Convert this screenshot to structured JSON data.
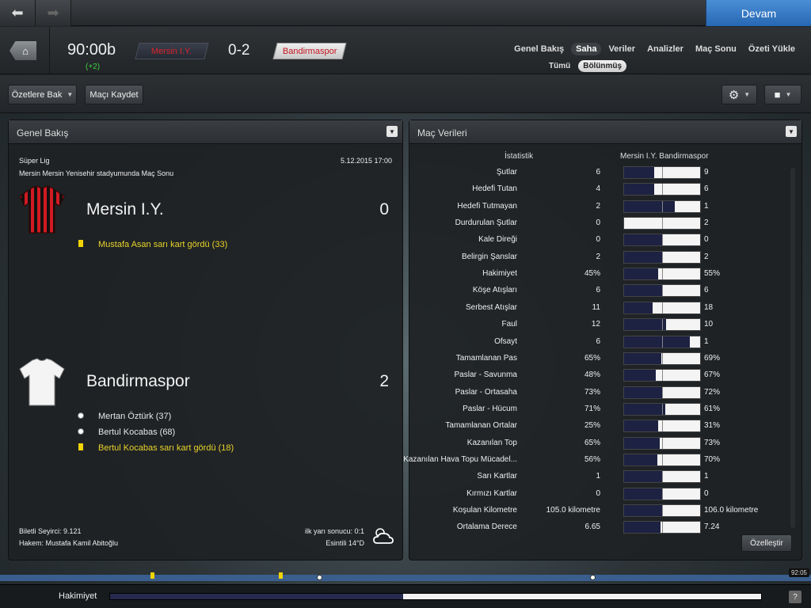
{
  "nav": {
    "continue_label": "Devam"
  },
  "header": {
    "clock": "90:00b",
    "added_time": "(+2)",
    "home_team": "Mersin I.Y.",
    "away_team": "Bandirmaspor",
    "score": "0-2",
    "tabs": [
      "Genel Bakış",
      "Saha",
      "Veriler",
      "Analizler",
      "Maç Sonu",
      "Özeti Yükle"
    ],
    "active_tab": "Saha",
    "subtabs": [
      "Tümü",
      "Bölünmüş"
    ],
    "active_subtab": "Bölünmüş"
  },
  "toolbar": {
    "highlights_label": "Özetlere Bak",
    "save_label": "Maçı Kaydet"
  },
  "overview": {
    "title": "Genel Bakış",
    "league": "Süper Lig",
    "datetime": "5.12.2015 17:00",
    "venue": "Mersin Mersin Yenisehir stadyumunda Maç Sonu",
    "home": {
      "name": "Mersin I.Y.",
      "goals": "0",
      "events": [
        {
          "type": "yellow-card",
          "text": "Mustafa Asan sarı kart gördü (33)"
        }
      ]
    },
    "away": {
      "name": "Bandirmaspor",
      "goals": "2",
      "events": [
        {
          "type": "goal",
          "text": "Mertan Öztürk (37)"
        },
        {
          "type": "goal",
          "text": "Bertul Kocabas (68)"
        },
        {
          "type": "yellow-card",
          "text": "Bertul Kocabas sarı kart gördü (18)"
        }
      ]
    },
    "attendance": "Biletli Seyirci: 9.121",
    "referee": "Hakem: Mustafa Kamil Abitoğlu",
    "half_time": "ilk yarı sonucu: 0:1",
    "weather": "Esintili 14°D"
  },
  "stats": {
    "title": "Maç Verileri",
    "col_stat": "İstatistik",
    "col_teams": "Mersin I.Y. Bandirmaspor",
    "customize_label": "Özelleştir",
    "rows": [
      {
        "label": "Şutlar",
        "home": "6",
        "away": "9",
        "share": 0.4
      },
      {
        "label": "Hedefi Tutan",
        "home": "4",
        "away": "6",
        "share": 0.4
      },
      {
        "label": "Hedefi Tutmayan",
        "home": "2",
        "away": "1",
        "share": 0.67
      },
      {
        "label": "Durdurulan Şutlar",
        "home": "0",
        "away": "2",
        "share": 0.0
      },
      {
        "label": "Kale Direği",
        "home": "0",
        "away": "0",
        "share": 0.5
      },
      {
        "label": "Belirgin Şanslar",
        "home": "2",
        "away": "2",
        "share": 0.5
      },
      {
        "label": "Hakimiyet",
        "home": "45%",
        "away": "55%",
        "share": 0.45
      },
      {
        "label": "Köşe Atışları",
        "home": "6",
        "away": "6",
        "share": 0.5
      },
      {
        "label": "Serbest Atışlar",
        "home": "11",
        "away": "18",
        "share": 0.38
      },
      {
        "label": "Faul",
        "home": "12",
        "away": "10",
        "share": 0.55
      },
      {
        "label": "Ofsayt",
        "home": "6",
        "away": "1",
        "share": 0.86
      },
      {
        "label": "Tamamlanan Pas",
        "home": "65%",
        "away": "69%",
        "share": 0.485
      },
      {
        "label": "Paslar - Savunma",
        "home": "48%",
        "away": "67%",
        "share": 0.42
      },
      {
        "label": "Paslar - Ortasaha",
        "home": "73%",
        "away": "72%",
        "share": 0.503
      },
      {
        "label": "Paslar - Hücum",
        "home": "71%",
        "away": "61%",
        "share": 0.54
      },
      {
        "label": "Tamamlanan Ortalar",
        "home": "25%",
        "away": "31%",
        "share": 0.45
      },
      {
        "label": "Kazanılan Top",
        "home": "65%",
        "away": "73%",
        "share": 0.47
      },
      {
        "label": "Kazanılan Hava Topu Mücadel...",
        "home": "56%",
        "away": "70%",
        "share": 0.44
      },
      {
        "label": "Sarı Kartlar",
        "home": "1",
        "away": "1",
        "share": 0.5
      },
      {
        "label": "Kırmızı Kartlar",
        "home": "0",
        "away": "0",
        "share": 0.5
      },
      {
        "label": "Koşulan Kilometre",
        "home": "105.0 kilometre",
        "away": "106.0 kilometre",
        "share": 0.498
      },
      {
        "label": "Ortalama Derece",
        "home": "6.65",
        "away": "7.24",
        "share": 0.48
      }
    ]
  },
  "timeline": {
    "end_time": "92:05"
  },
  "bottom": {
    "possession_label": "Hakimiyet",
    "possession_home": 0.45
  },
  "colors": {
    "accent": "#2f74c4",
    "home_red": "#d9232b",
    "card_yellow": "#f1d400"
  }
}
